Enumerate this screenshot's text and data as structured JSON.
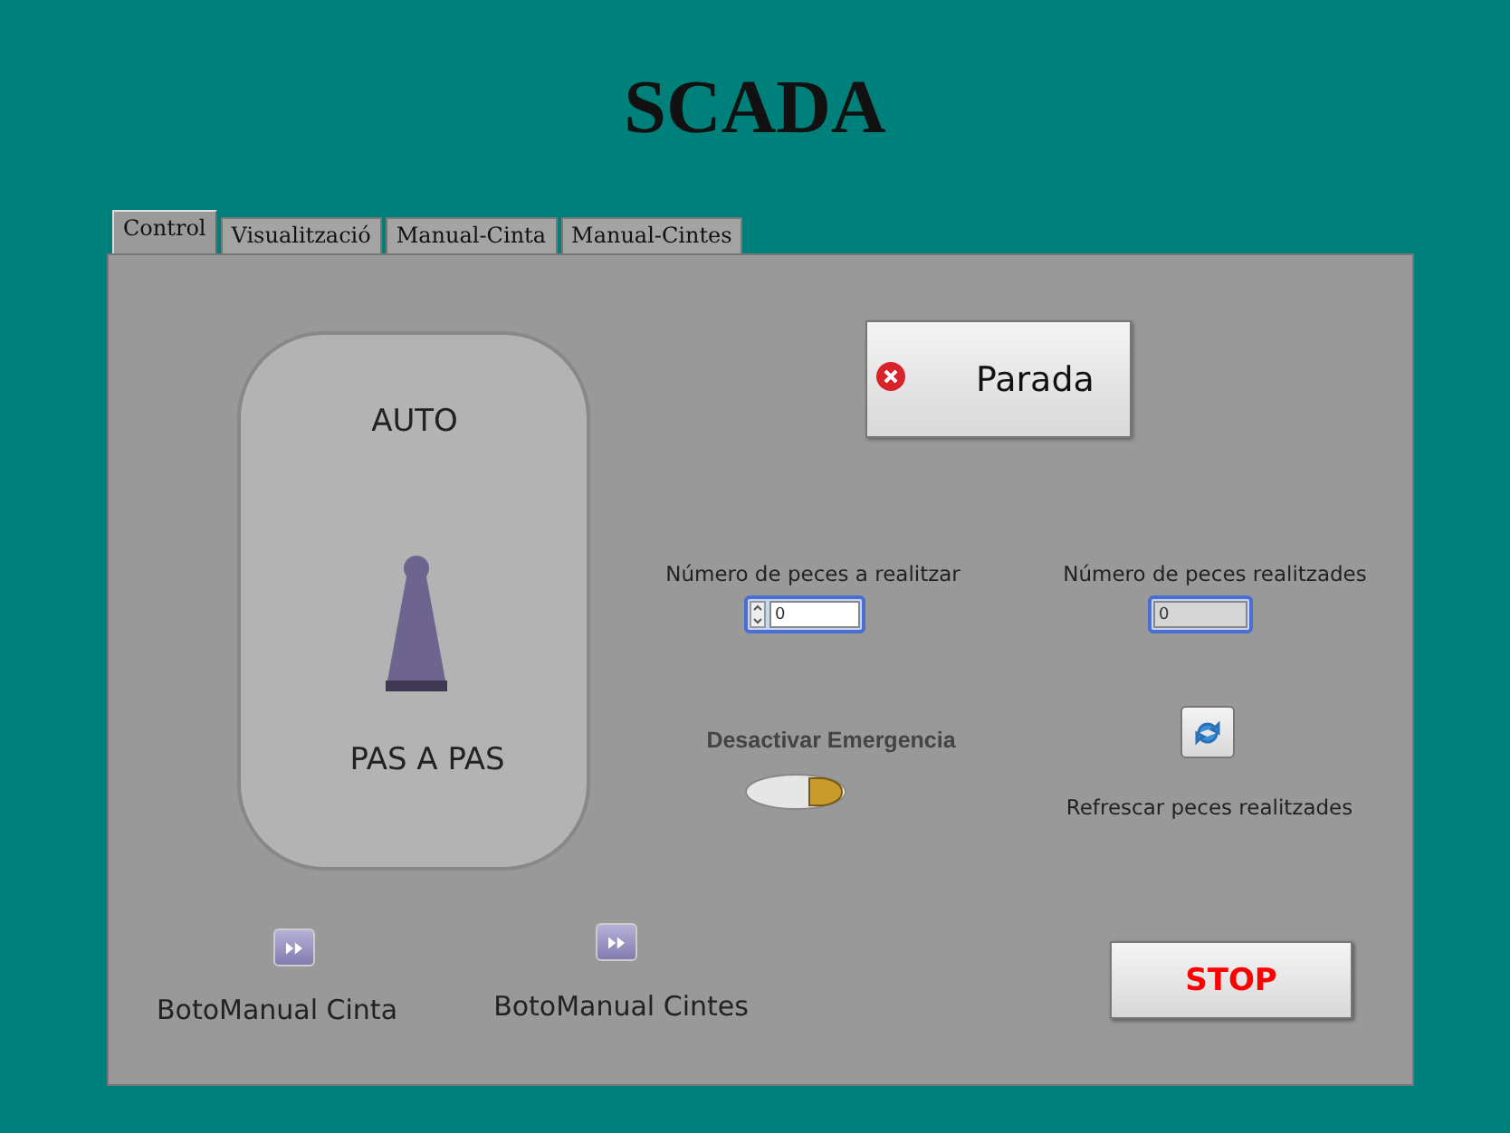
{
  "title": "SCADA",
  "tabs": [
    {
      "label": "Control",
      "selected": true
    },
    {
      "label": "Visualització",
      "selected": false
    },
    {
      "label": "Manual-Cinta",
      "selected": false
    },
    {
      "label": "Manual-Cintes",
      "selected": false
    }
  ],
  "mode_switch": {
    "top_label": "AUTO",
    "bottom_label": "PAS A PAS",
    "auto": true
  },
  "stop_state_button": {
    "label": "Parada"
  },
  "pieces_to_make": {
    "label": "Número de peces a realitzar",
    "value": "0"
  },
  "pieces_made": {
    "label": "Número de peces realitzades",
    "value": "0"
  },
  "emergency": {
    "label": "Desactivar Emergencia",
    "on": true
  },
  "refresh": {
    "label": "Refrescar peces realitzades"
  },
  "manual_buttons": [
    {
      "label": "BotoManual Cinta"
    },
    {
      "label": "BotoManual Cintes"
    }
  ],
  "stop_button": {
    "label": "STOP"
  }
}
